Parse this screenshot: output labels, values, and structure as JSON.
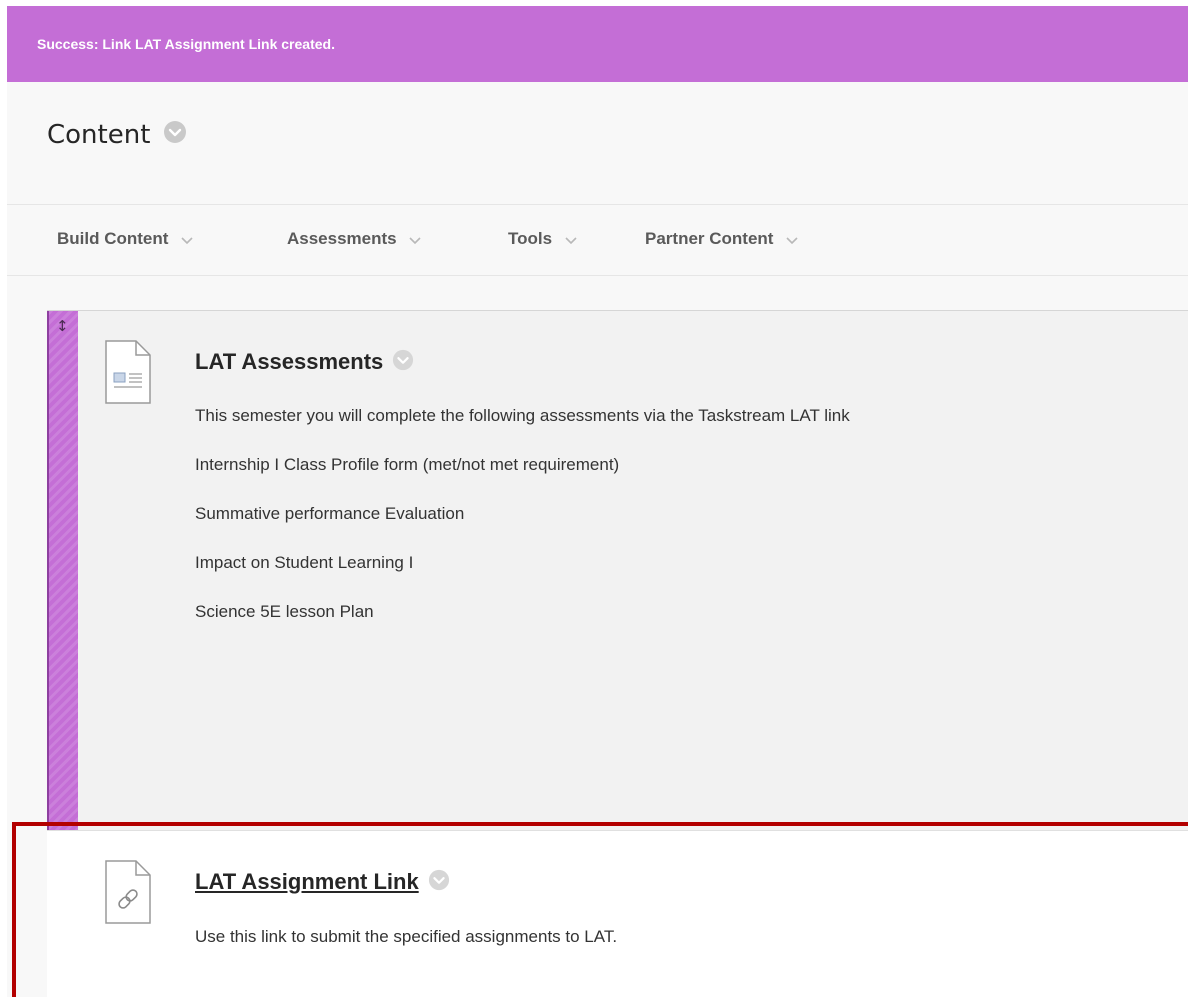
{
  "colors": {
    "accent": "#c46ed6",
    "highlight_border": "#b30000"
  },
  "banner": {
    "text": "Success: Link LAT Assignment Link created."
  },
  "header": {
    "title": "Content"
  },
  "toolbar": {
    "items": [
      {
        "label": "Build Content"
      },
      {
        "label": "Assessments"
      },
      {
        "label": "Tools"
      },
      {
        "label": "Partner Content"
      }
    ]
  },
  "items": [
    {
      "icon": "document-icon",
      "title": "LAT Assessments",
      "lines": [
        "This semester you will complete the following assessments via the Taskstream LAT link",
        "Internship I Class Profile form (met/not met requirement)",
        "Summative performance Evaluation",
        "Impact on Student Learning I",
        "Science 5E lesson Plan"
      ]
    },
    {
      "icon": "link-icon",
      "title": "LAT Assignment Link",
      "lines": [
        "Use this link to submit the specified assignments to LAT."
      ]
    }
  ]
}
